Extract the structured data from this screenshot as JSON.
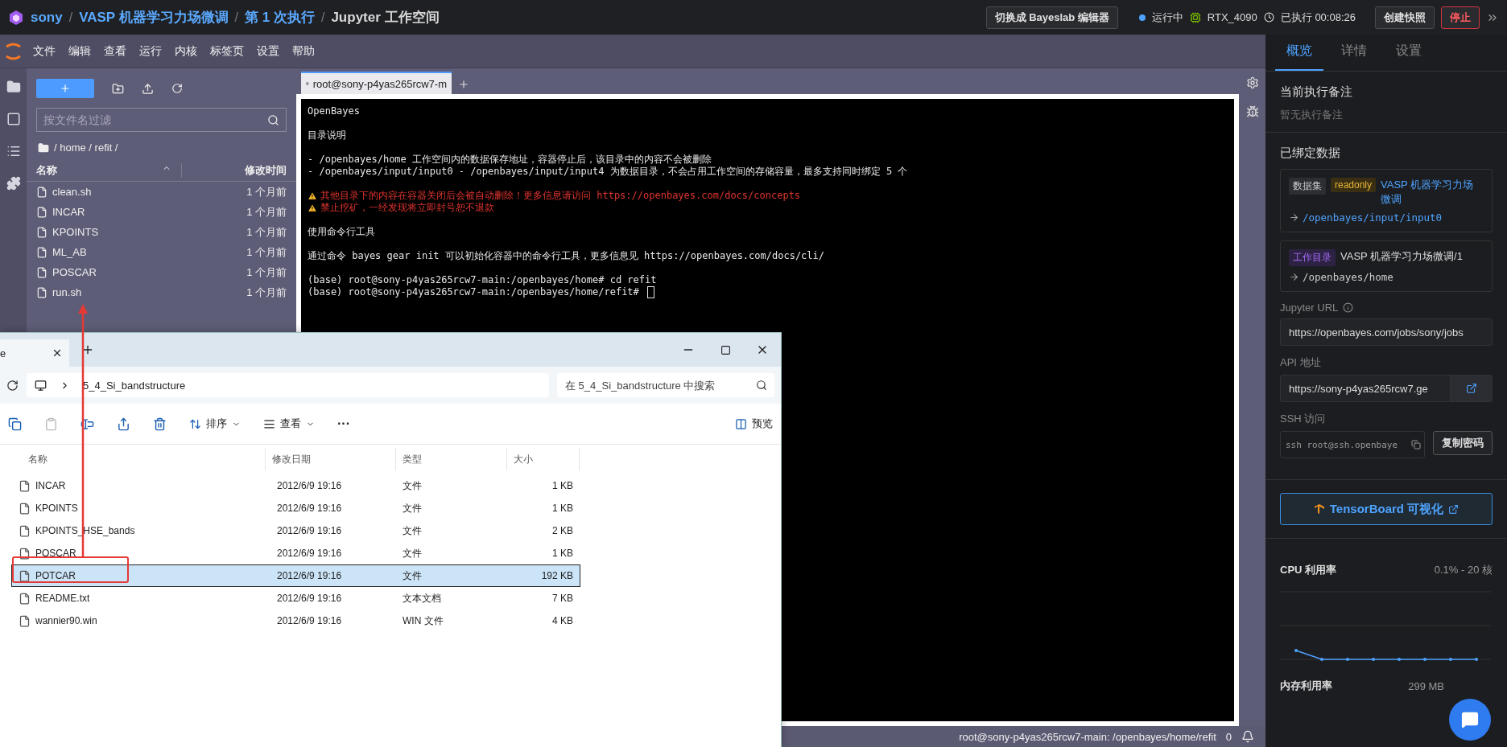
{
  "top_bar": {
    "breadcrumb": [
      {
        "label": "sony",
        "kind": "link"
      },
      {
        "label": "VASP 机器学习力场微调",
        "kind": "link"
      },
      {
        "label": "第 1 次执行",
        "kind": "link"
      },
      {
        "label": "Jupyter 工作空间",
        "kind": "current"
      }
    ],
    "separator": "/",
    "switch_button": "切换成 Bayeslab 编辑器",
    "status": "运行中",
    "gpu": "RTX_4090",
    "elapsed": "已执行 00:08:26",
    "snapshot_button": "创建快照",
    "stop_button": "停止"
  },
  "menu": [
    "文件",
    "编辑",
    "查看",
    "运行",
    "内核",
    "标签页",
    "设置",
    "帮助"
  ],
  "file_browser": {
    "filter_placeholder": "按文件名过滤",
    "path": "/ home / refit /",
    "columns": [
      "名称",
      "修改时间"
    ],
    "files": [
      {
        "name": "clean.sh",
        "modified": "1 个月前"
      },
      {
        "name": "INCAR",
        "modified": "1 个月前"
      },
      {
        "name": "KPOINTS",
        "modified": "1 个月前"
      },
      {
        "name": "ML_AB",
        "modified": "1 个月前"
      },
      {
        "name": "POSCAR",
        "modified": "1 个月前"
      },
      {
        "name": "run.sh",
        "modified": "1 个月前"
      }
    ]
  },
  "terminal": {
    "tab": "root@sony-p4yas265rcw7-m",
    "lines": [
      {
        "kind": "text",
        "text": "OpenBayes"
      },
      {
        "kind": "blank"
      },
      {
        "kind": "text",
        "text": "目录说明"
      },
      {
        "kind": "blank"
      },
      {
        "kind": "text",
        "text": "- /openbayes/home 工作空间内的数据保存地址，容器停止后，该目录中的内容不会被删除"
      },
      {
        "kind": "text",
        "text": "- /openbayes/input/input0 - /openbayes/input/input4 为数据目录，不会占用工作空间的存储容量，最多支持同时绑定 5 个"
      },
      {
        "kind": "blank"
      },
      {
        "kind": "warning",
        "text": "其他目录下的内容在容器关闭后会被自动删除！更多信息请访问 https://openbayes.com/docs/concepts"
      },
      {
        "kind": "warning",
        "text": "禁止挖矿，一经发现将立即封号恕不退款"
      },
      {
        "kind": "blank"
      },
      {
        "kind": "text",
        "text": "使用命令行工具"
      },
      {
        "kind": "blank"
      },
      {
        "kind": "text",
        "text": "通过命令 bayes gear init 可以初始化容器中的命令行工具，更多信息见 https://openbayes.com/docs/cli/"
      },
      {
        "kind": "blank"
      },
      {
        "kind": "text",
        "text": "(base) root@sony-p4yas265rcw7-main:/openbayes/home# cd refit"
      },
      {
        "kind": "prompt",
        "text": "(base) root@sony-p4yas265rcw7-main:/openbayes/home/refit#"
      }
    ]
  },
  "status_bar": {
    "text": "root@sony-p4yas265rcw7-main: /openbayes/home/refit",
    "count": "0"
  },
  "side_panel": {
    "tabs": [
      {
        "label": "概览",
        "selected": true
      },
      {
        "label": "详情",
        "selected": false
      },
      {
        "label": "设置",
        "selected": false
      }
    ],
    "note_title": "当前执行备注",
    "note_empty": "暂无执行备注",
    "bound_title": "已绑定数据",
    "bindings": [
      {
        "tags": [
          {
            "label": "数据集",
            "kind": "dataset"
          },
          {
            "label": "readonly",
            "kind": "readonly"
          }
        ],
        "name": "VASP 机器学习力场微调",
        "path": "/openbayes/input/input0"
      },
      {
        "tags": [
          {
            "label": "工作目录",
            "kind": "workdir"
          }
        ],
        "name": "VASP 机器学习力场微调/1",
        "path": "/openbayes/home"
      }
    ],
    "jupyter_label": "Jupyter URL",
    "jupyter_url": "https://openbayes.com/jobs/sony/jobs",
    "api_label": "API 地址",
    "api_url": "https://sony-p4yas265rcw7.ge",
    "ssh_label": "SSH 访问",
    "ssh_command": "ssh root@ssh.openbaye",
    "copy_password": "复制密码",
    "tensorboard": "TensorBoard 可视化",
    "cpu_label": "CPU 利用率",
    "cpu_value": "0.1% - 20 核",
    "mem_label": "内存利用率",
    "mem_value": "299 MB"
  },
  "explorer": {
    "tab": "e",
    "path": "5_4_Si_bandstructure",
    "search_placeholder": "在 5_4_Si_bandstructure 中搜索",
    "toolbar": [
      {
        "kind": "copy"
      },
      {
        "kind": "paste",
        "disabled": true
      },
      {
        "kind": "rename"
      },
      {
        "kind": "share"
      },
      {
        "kind": "delete"
      }
    ],
    "sort": "排序",
    "view": "查看",
    "more": "···",
    "preview": "预览",
    "columns": [
      "名称",
      "修改日期",
      "类型",
      "大小"
    ],
    "files": [
      {
        "name": "INCAR",
        "modified": "2012/6/9 19:16",
        "type": "文件",
        "size": "1 KB",
        "selected": false
      },
      {
        "name": "KPOINTS",
        "modified": "2012/6/9 19:16",
        "type": "文件",
        "size": "1 KB",
        "selected": false
      },
      {
        "name": "KPOINTS_HSE_bands",
        "modified": "2012/6/9 19:16",
        "type": "文件",
        "size": "2 KB",
        "selected": false
      },
      {
        "name": "POSCAR",
        "modified": "2012/6/9 19:16",
        "type": "文件",
        "size": "1 KB",
        "selected": false
      },
      {
        "name": "POTCAR",
        "modified": "2012/6/9 19:16",
        "type": "文件",
        "size": "192 KB",
        "selected": true
      },
      {
        "name": "README.txt",
        "modified": "2012/6/9 19:16",
        "type": "文本文档",
        "size": "7 KB",
        "selected": false
      },
      {
        "name": "wannier90.win",
        "modified": "2012/6/9 19:16",
        "type": "WIN 文件",
        "size": "4 KB",
        "selected": false
      }
    ]
  }
}
